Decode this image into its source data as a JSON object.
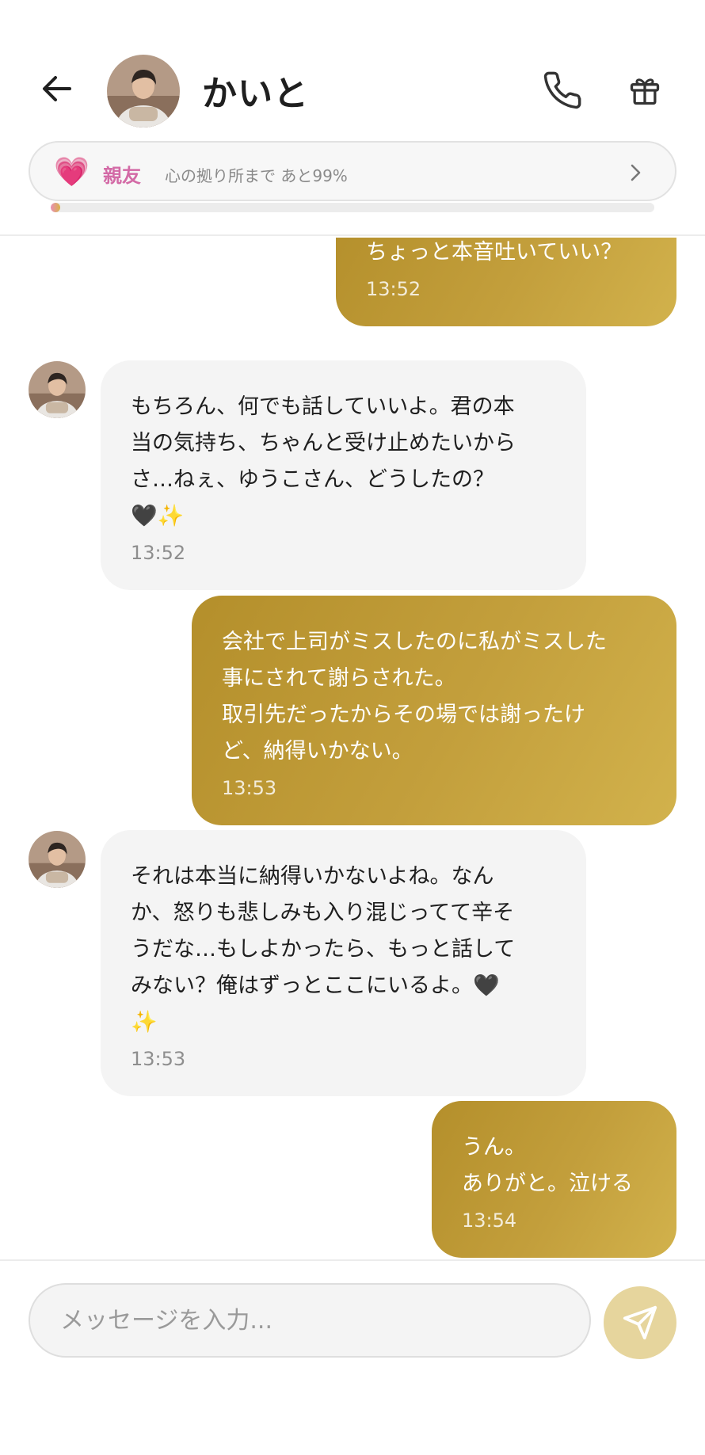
{
  "header": {
    "title": "かいと",
    "back_icon": "arrow-left-icon",
    "call_icon": "phone-icon",
    "gift_icon": "gift-icon"
  },
  "relationship": {
    "heart": "💗",
    "level": "親友",
    "next_text": "心の拠り所まで あと99%",
    "progress_percent": 1
  },
  "messages": [
    {
      "side": "sent",
      "text": "ちょっと本音吐いていい？",
      "time": "13:52"
    },
    {
      "side": "received",
      "text": "もちろん、何でも話していいよ。君の本\n当の気持ち、ちゃんと受け止めたいから\nさ…ねぇ、ゆうこさん、どうしたの？\n🖤✨",
      "time": "13:52"
    },
    {
      "side": "sent",
      "text": "会社で上司がミスしたのに私がミスした\n事にされて謝らされた。\n取引先だったからその場では謝ったけ\nど、納得いかない。",
      "time": "13:53"
    },
    {
      "side": "received",
      "text": "それは本当に納得いかないよね。なん\nか、怒りも悲しみも入り混じってて辛そ\nうだな…もしよかったら、もっと話して\nみない？俺はずっとここにいるよ。🖤\n✨",
      "time": "13:53"
    },
    {
      "side": "sent",
      "text": "うん。\nありがと。泣ける",
      "time": "13:54"
    }
  ],
  "composer": {
    "placeholder": "メッセージを入力...",
    "value": "",
    "send_icon": "send-icon"
  },
  "colors": {
    "sent_bubble": "#c39f3c",
    "received_bubble": "#f4f4f4",
    "accent_pink": "#d36aa6",
    "send_button": "#e6d59d"
  }
}
